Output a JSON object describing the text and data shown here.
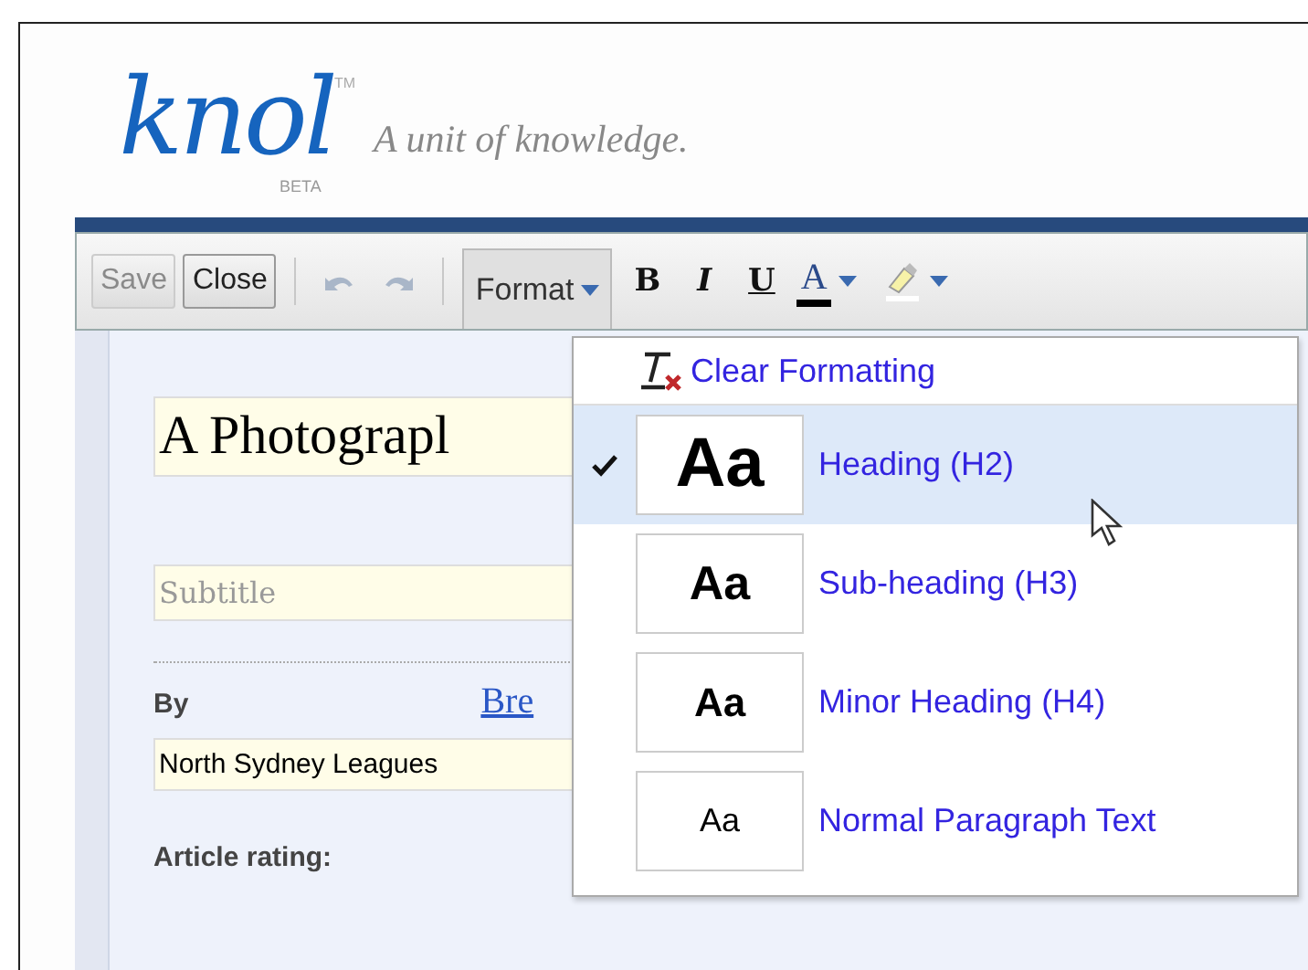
{
  "header": {
    "logo": "knol",
    "trademark": "TM",
    "beta": "BETA",
    "tagline": "A unit of knowledge."
  },
  "toolbar": {
    "save": {
      "label": "Save",
      "disabled": true
    },
    "close": {
      "label": "Close",
      "disabled": false
    },
    "format": {
      "label": "Format",
      "expanded": true
    },
    "bold": "B",
    "italic": "I",
    "underline": "U",
    "text_color": "A"
  },
  "editor": {
    "title": "A Photograpl",
    "subtitle_placeholder": "Subtitle",
    "by_label": "By",
    "author_link": "Bre",
    "affiliation": "North Sydney Leagues",
    "rating_label": "Article rating:"
  },
  "format_menu": {
    "clear": "Clear Formatting",
    "items": [
      {
        "kind": "h2",
        "sample": "Aa",
        "label": "Heading (H2)",
        "selected": true
      },
      {
        "kind": "h3",
        "sample": "Aa",
        "label": "Sub-heading (H3)",
        "selected": false
      },
      {
        "kind": "h4",
        "sample": "Aa",
        "label": "Minor Heading (H4)",
        "selected": false
      },
      {
        "kind": "p",
        "sample": "Aa",
        "label": "Normal Paragraph Text",
        "selected": false
      }
    ]
  }
}
